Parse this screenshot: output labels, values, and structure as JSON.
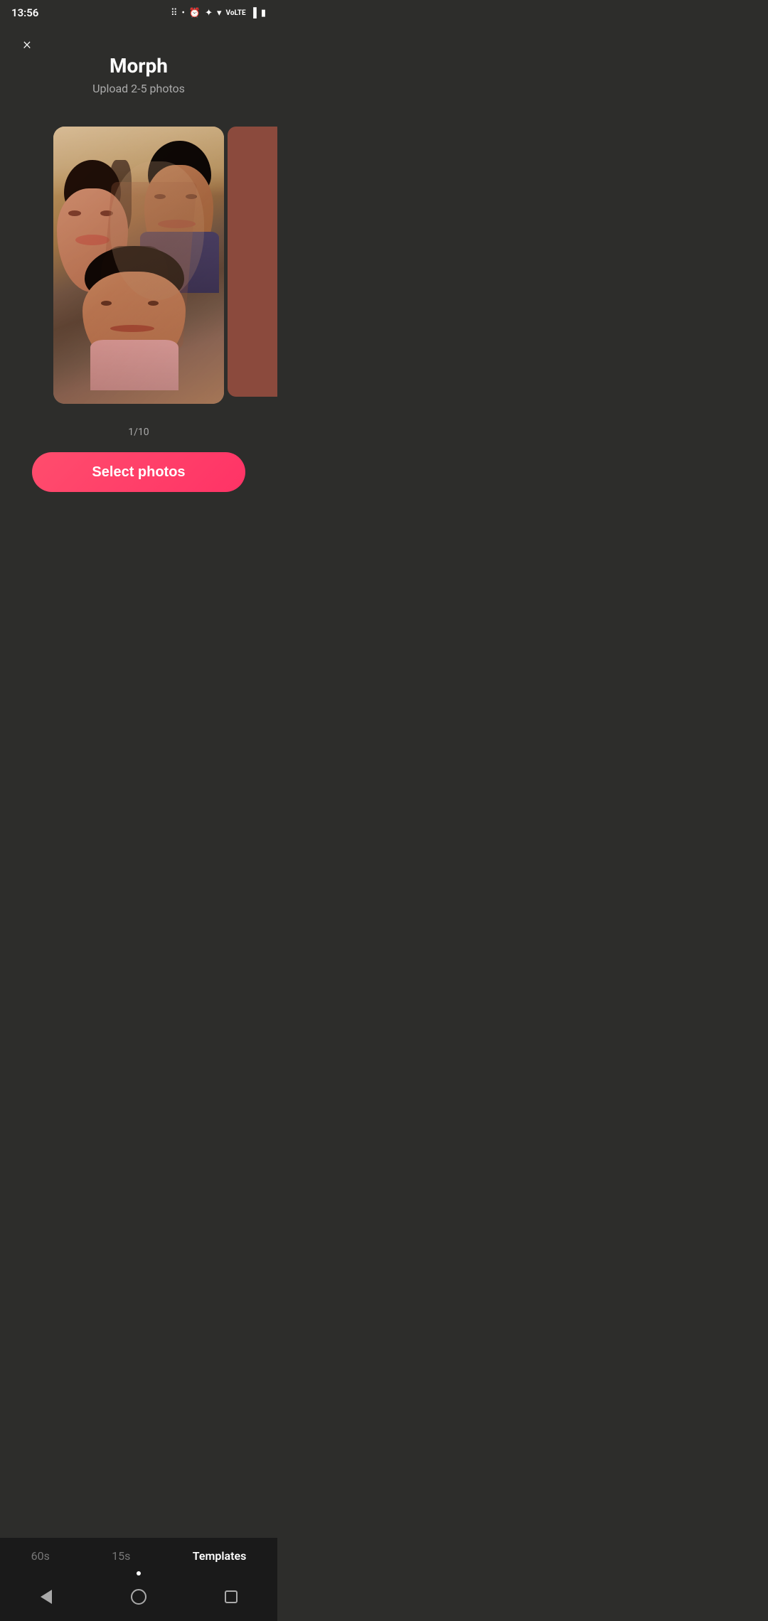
{
  "statusBar": {
    "time": "13:56",
    "icons": [
      "sound-wave",
      "dot-indicator",
      "alarm",
      "bluetooth",
      "wifi",
      "lte",
      "signal",
      "battery"
    ]
  },
  "header": {
    "title": "Morph",
    "subtitle": "Upload 2-5 photos"
  },
  "carousel": {
    "pagination": "1/10"
  },
  "selectButton": {
    "label": "Select photos"
  },
  "bottomNav": {
    "tabs": [
      {
        "label": "60s",
        "active": false
      },
      {
        "label": "15s",
        "active": false
      },
      {
        "label": "Templates",
        "active": true
      }
    ]
  },
  "systemNav": {
    "back": "back",
    "home": "home",
    "recent": "recent"
  },
  "close": {
    "label": "×"
  }
}
